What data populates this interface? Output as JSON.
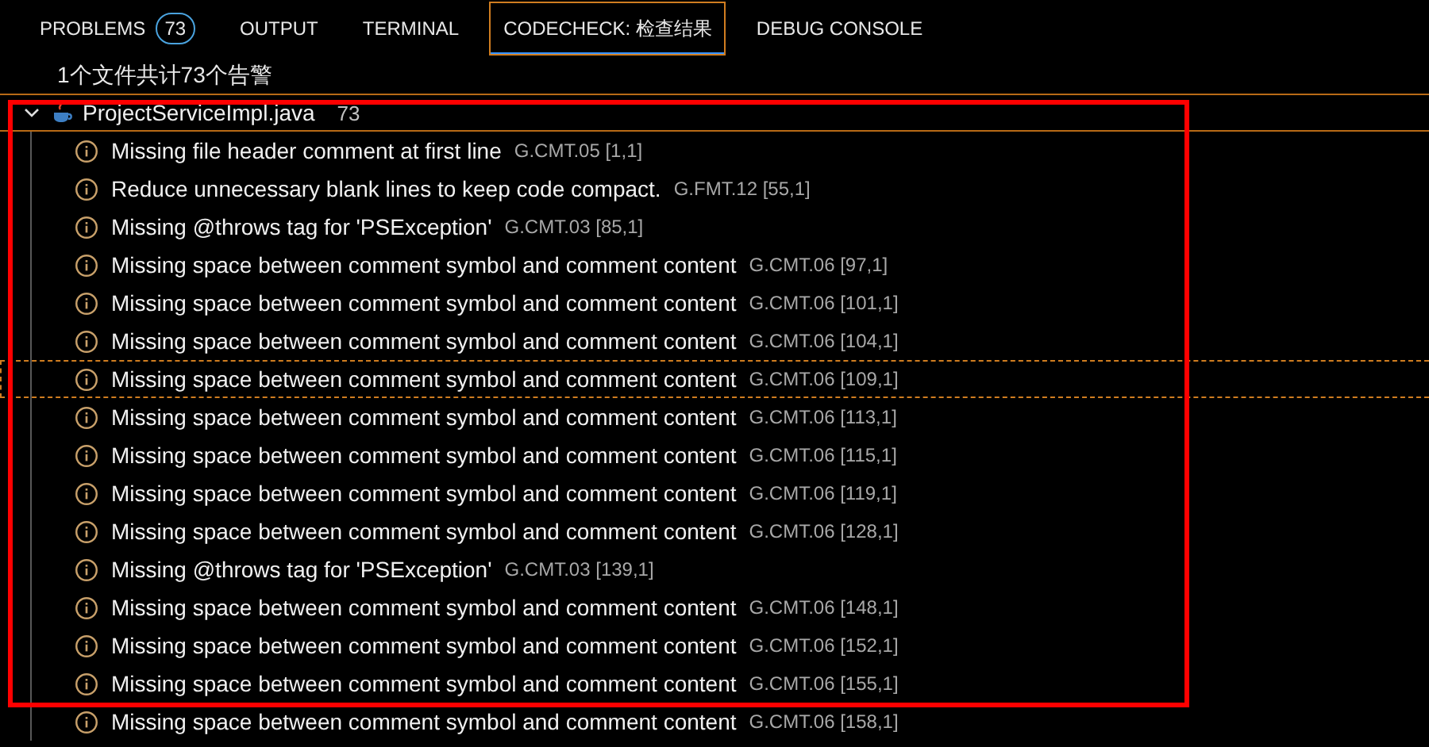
{
  "tabs": [
    {
      "label": "PROBLEMS",
      "badge": "73",
      "selected": false
    },
    {
      "label": "OUTPUT",
      "selected": false
    },
    {
      "label": "TERMINAL",
      "selected": false
    },
    {
      "label": "CODECHECK: 检查结果",
      "selected": true
    },
    {
      "label": "DEBUG CONSOLE",
      "selected": false
    }
  ],
  "summary": "1个文件共计73个告警",
  "file": {
    "name": "ProjectServiceImpl.java",
    "count": "73",
    "expanded": true,
    "focused": true
  },
  "items": [
    {
      "message": "Missing file header comment at first line",
      "rule": "G.CMT.05 [1,1]",
      "focused": false
    },
    {
      "message": "Reduce unnecessary blank lines to keep code compact.",
      "rule": "G.FMT.12 [55,1]",
      "focused": false
    },
    {
      "message": "Missing @throws tag for 'PSException'",
      "rule": "G.CMT.03 [85,1]",
      "focused": false
    },
    {
      "message": "Missing space between comment symbol and comment content",
      "rule": "G.CMT.06 [97,1]",
      "focused": false
    },
    {
      "message": "Missing space between comment symbol and comment content",
      "rule": "G.CMT.06 [101,1]",
      "focused": false
    },
    {
      "message": "Missing space between comment symbol and comment content",
      "rule": "G.CMT.06 [104,1]",
      "focused": false
    },
    {
      "message": "Missing space between comment symbol and comment content",
      "rule": "G.CMT.06 [109,1]",
      "focused": true
    },
    {
      "message": "Missing space between comment symbol and comment content",
      "rule": "G.CMT.06 [113,1]",
      "focused": false
    },
    {
      "message": "Missing space between comment symbol and comment content",
      "rule": "G.CMT.06 [115,1]",
      "focused": false
    },
    {
      "message": "Missing space between comment symbol and comment content",
      "rule": "G.CMT.06 [119,1]",
      "focused": false
    },
    {
      "message": "Missing space between comment symbol and comment content",
      "rule": "G.CMT.06 [128,1]",
      "focused": false
    },
    {
      "message": "Missing @throws tag for 'PSException'",
      "rule": "G.CMT.03 [139,1]",
      "focused": false
    },
    {
      "message": "Missing space between comment symbol and comment content",
      "rule": "G.CMT.06 [148,1]",
      "focused": false
    },
    {
      "message": "Missing space between comment symbol and comment content",
      "rule": "G.CMT.06 [152,1]",
      "focused": false
    },
    {
      "message": "Missing space between comment symbol and comment content",
      "rule": "G.CMT.06 [155,1]",
      "focused": false
    },
    {
      "message": "Missing space between comment symbol and comment content",
      "rule": "G.CMT.06 [158,1]",
      "focused": false
    }
  ]
}
